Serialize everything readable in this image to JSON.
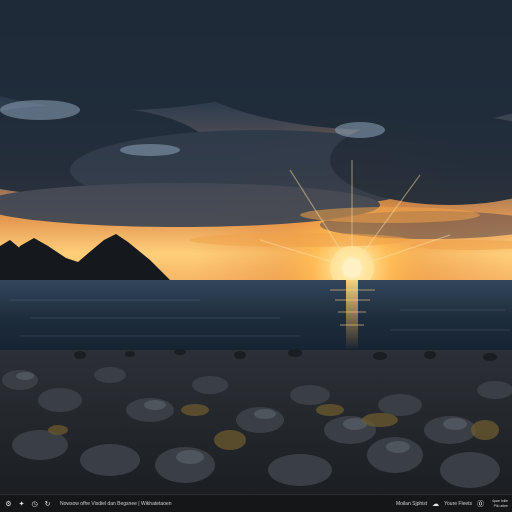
{
  "scene": {
    "description_icons": [
      "sun",
      "mountain",
      "sea",
      "rocks",
      "clouds"
    ],
    "colors": {
      "sky_top": "#1d2a38",
      "sky_glow": "#f6a23c",
      "sun_core": "#fff2c2",
      "sea": "#1c2b3a",
      "rocks": "#2f3338"
    }
  },
  "taskbar": {
    "icons": [
      "settings-icon",
      "lightbulb-icon",
      "clock-icon",
      "refresh-icon"
    ],
    "title": "Nowsow ofhe Visdiel dan Begsnee | Wikhatetaoen",
    "status_left": "Moilan Sjphist",
    "status_right": "Youre Fleets",
    "clock_top": "4pae foiile",
    "clock_bottom": "Pilo atiee"
  }
}
